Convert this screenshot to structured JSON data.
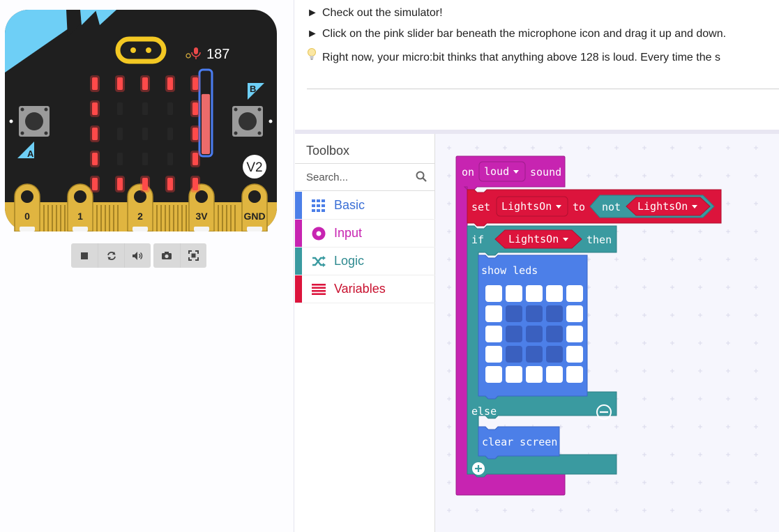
{
  "simulator": {
    "sound_level": "187",
    "sound_level_fraction": 0.73,
    "version_badge": "V2",
    "button_a": "A",
    "button_b": "B",
    "pins": [
      "0",
      "1",
      "2",
      "3V",
      "GND"
    ],
    "led_matrix": [
      [
        1,
        1,
        1,
        1,
        1
      ],
      [
        1,
        0,
        0,
        0,
        1
      ],
      [
        1,
        0,
        0,
        0,
        1
      ],
      [
        1,
        0,
        0,
        0,
        1
      ],
      [
        1,
        1,
        1,
        1,
        1
      ]
    ],
    "colors": {
      "board": "#1f1f1f",
      "led_on": "#ff3b3b",
      "accent": "#6ecff6",
      "pin": "#e0b540",
      "slider": "#ec6b6b"
    },
    "toolbar": {
      "stop_icon": "stop-icon",
      "restart_icon": "restart-icon",
      "mute_icon": "speaker-icon",
      "screenshot_icon": "camera-icon",
      "fullscreen_icon": "fullscreen-icon"
    }
  },
  "instructions": {
    "line1": "Check out the simulator!",
    "line2": "Click on the pink slider bar beneath the microphone icon and drag it up and down.",
    "line3": "Right now, your micro:bit thinks that anything above 128 is loud. Every time the s",
    "marker": "►"
  },
  "toolbox": {
    "title": "Toolbox",
    "search_placeholder": "Search...",
    "categories": [
      {
        "label": "Basic",
        "color": "#1e90ff",
        "icon": "grid-icon"
      },
      {
        "label": "Input",
        "color": "#c724b1",
        "icon": "circle-icon"
      },
      {
        "label": "Logic",
        "color": "#3a9aa0",
        "icon": "shuffle-icon"
      },
      {
        "label": "Variables",
        "color": "#dc143c",
        "icon": "list-icon"
      }
    ]
  },
  "blocks": {
    "on": "on",
    "event": "loud",
    "sound": "sound",
    "set": "set",
    "variable": "LightsOn",
    "to": "to",
    "not": "not",
    "if": "if",
    "then": "then",
    "show_leds": "show leds",
    "else": "else",
    "clear_screen": "clear screen",
    "led_pattern": [
      [
        1,
        1,
        1,
        1,
        1
      ],
      [
        1,
        0,
        0,
        0,
        1
      ],
      [
        1,
        0,
        0,
        0,
        1
      ],
      [
        1,
        0,
        0,
        0,
        1
      ],
      [
        1,
        1,
        1,
        1,
        1
      ]
    ],
    "colors": {
      "input": "#c724b1",
      "variables": "#dc143c",
      "logic": "#3a9aa0",
      "basic": "#4c7fe8"
    }
  }
}
